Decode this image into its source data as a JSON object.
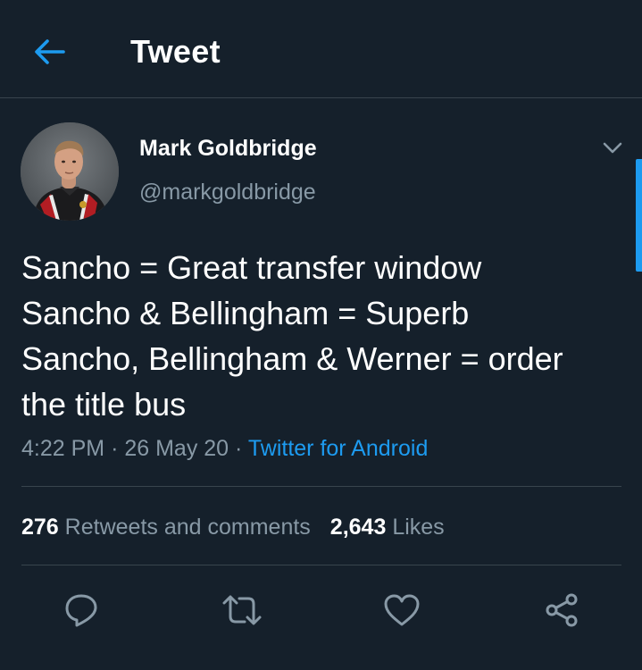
{
  "header": {
    "title": "Tweet",
    "back_icon": "arrow-left-icon"
  },
  "author": {
    "display_name": "Mark Goldbridge",
    "handle": "@markgoldbridge",
    "avatar": "profile-photo"
  },
  "tweet": {
    "lines": [
      "Sancho = Great transfer window",
      "Sancho & Bellingham = Superb",
      "Sancho, Bellingham & Werner = order",
      "the title bus"
    ],
    "time": "4:22 PM",
    "separator": "·",
    "date": "26 May 20",
    "source": "Twitter for Android"
  },
  "stats": {
    "retweets_count": "276",
    "retweets_label": "Retweets and comments",
    "likes_count": "2,643",
    "likes_label": "Likes"
  },
  "actions": [
    "reply-icon",
    "retweet-icon",
    "like-icon",
    "share-icon"
  ],
  "colors": {
    "background": "#15202b",
    "accent": "#1d9bf0",
    "secondary_text": "#8899a6",
    "divider": "#38444d"
  }
}
